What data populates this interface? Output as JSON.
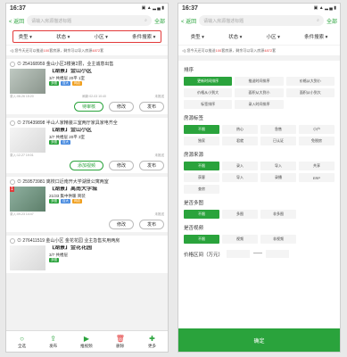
{
  "status": {
    "time": "16:37",
    "icons": "▣ ▲ ▂ ▄ ▮"
  },
  "topbar": {
    "back": "< 返回",
    "search_placeholder": "请输入房源描述标题",
    "all": "全部"
  },
  "filters": [
    "类型 ▾",
    "状态 ▾",
    "小区 ▾",
    "条件搜索 ▾"
  ],
  "tip": {
    "pre": "您今天还可以推送",
    "n1": "100",
    "mid": "套房源，剩余可以导入房源",
    "n2": "4872",
    "post": "套"
  },
  "cards": [
    {
      "head": "⊙ 254168959 金山小区3楼第2层，业主诚意出售",
      "title": "【湖景】金山小区",
      "d1": "3/7 共楼层 20平 1室",
      "tags": [
        "多图",
        "百大",
        "网店"
      ],
      "left": "录入:08-26 15:20",
      "mid": "刷新:02-03 10:40",
      "right": "未推送",
      "btns": [
        "待审核",
        "修改",
        "发布"
      ]
    },
    {
      "head": "⊙ 276439898 半山人家精装三室两厅家具家电齐全",
      "title": "【湖景】金山小区",
      "d1": "3/7 共楼层 20平 3室",
      "tags": [
        "多图",
        "百大"
      ],
      "left": "录入:12-27 19:01",
      "mid": "",
      "right": "未推送",
      "btns": [
        "添加视频",
        "修改",
        "发布"
      ]
    },
    {
      "head": "⊙ 259573981 离校口近南开大学湖景公寓两室",
      "title": "【湖景】离南大学城",
      "d1": "21/33 集中供暖 简装",
      "tags": [
        "多图",
        "百大",
        "网店"
      ],
      "left": "录入:09-23 14:47",
      "mid": "",
      "right": "未推送",
      "btns": [
        "修改",
        "发布"
      ]
    },
    {
      "head": "⊙ 276411519 金山小区 金花花园 业主急售实用两房",
      "title": "【湖景】金花花园",
      "d1": "3/7 共楼层",
      "tags": [
        "多图"
      ],
      "left": "",
      "mid": "",
      "right": "",
      "btns": []
    }
  ],
  "bottom": [
    "全选",
    "发布",
    "推视频",
    "删除",
    "更多"
  ],
  "panel": {
    "sort_title": "排序",
    "sort": [
      "更新时间排序",
      "推送时间排序",
      "价格从大到小",
      "价格从小到大",
      "面积从大到小",
      "面积从小到大",
      "标签排序",
      "录入时间排序"
    ],
    "tag_title": "房源标签",
    "tags": [
      "不限",
      "热心",
      "急售",
      "小户",
      "独家",
      "君就",
      "已认证",
      "免税房"
    ],
    "src_title": "房源来源",
    "src": [
      "不限",
      "录入",
      "导入",
      "共享",
      "获客",
      "导入",
      "录播",
      "ERP",
      "查房"
    ],
    "img_title": "是否多图",
    "img": [
      "不限",
      "多图",
      "非多图"
    ],
    "vid_title": "是否视频",
    "vid": [
      "不限",
      "视频",
      "非视频"
    ],
    "price_title": "价格区间（万元）",
    "price_sep": "——",
    "ok": "确定"
  }
}
